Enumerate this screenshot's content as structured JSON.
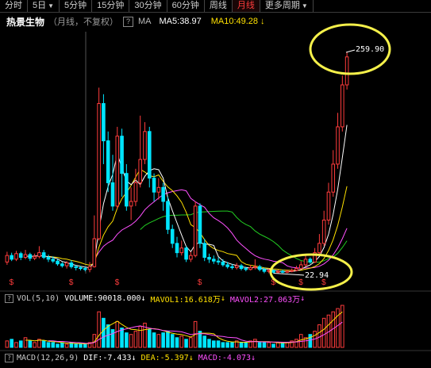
{
  "tabs": [
    {
      "label": "分时",
      "active": false
    },
    {
      "label": "5日",
      "active": false,
      "dropdown": true
    },
    {
      "label": "5分钟",
      "active": false
    },
    {
      "label": "15分钟",
      "active": false
    },
    {
      "label": "30分钟",
      "active": false
    },
    {
      "label": "60分钟",
      "active": false
    },
    {
      "label": "周线",
      "active": false
    },
    {
      "label": "月线",
      "active": true
    },
    {
      "label": "更多周期",
      "active": false,
      "dropdown": true
    }
  ],
  "title": {
    "stock_name": "热景生物",
    "subtitle": "（月线，不复权）",
    "help": "?",
    "indicator": "MA",
    "ma5": "MA5:38.97",
    "ma10": "MA10:49.28",
    "ma10_arrow": "↓"
  },
  "price_labels": {
    "high": "259.90",
    "low": "22.94"
  },
  "volume": {
    "indicator": "VOL(5,10)",
    "volume": "VOLUME:90018.000",
    "volume_arrow": "↓",
    "mavol1": "MAVOL1:16.618万",
    "mavol1_arrow": "↓",
    "mavol2": "MAVOL2:27.063万",
    "mavol2_arrow": "↓"
  },
  "macd": {
    "indicator": "MACD(12,26,9)",
    "dif": "DIF:-7.433",
    "dif_arrow": "↓",
    "dea": "DEA:-5.397",
    "dea_arrow": "↓",
    "macd": "MACD:-4.073",
    "macd_arrow": "↓"
  },
  "colors": {
    "up": "#ff3c3c",
    "down": "#00e5ff",
    "ma5": "#ffffff",
    "ma10": "#ffe100",
    "ma20": "#ff50ff",
    "ma30": "#22cc22",
    "annotation": "#f5f04a"
  },
  "chart_data": {
    "type": "candlestick",
    "period": "monthly",
    "high_marker": 259.9,
    "low_marker": 22.94,
    "candles": [
      {
        "o": 35,
        "c": 42,
        "h": 46,
        "l": 32
      },
      {
        "o": 42,
        "c": 38,
        "h": 45,
        "l": 36
      },
      {
        "o": 38,
        "c": 44,
        "h": 47,
        "l": 36
      },
      {
        "o": 44,
        "c": 40,
        "h": 46,
        "l": 37
      },
      {
        "o": 40,
        "c": 43,
        "h": 48,
        "l": 38
      },
      {
        "o": 43,
        "c": 39,
        "h": 45,
        "l": 36
      },
      {
        "o": 39,
        "c": 41,
        "h": 44,
        "l": 37
      },
      {
        "o": 41,
        "c": 45,
        "h": 52,
        "l": 39
      },
      {
        "o": 45,
        "c": 40,
        "h": 48,
        "l": 38
      },
      {
        "o": 40,
        "c": 38,
        "h": 43,
        "l": 35
      },
      {
        "o": 38,
        "c": 36,
        "h": 41,
        "l": 34
      },
      {
        "o": 36,
        "c": 33,
        "h": 38,
        "l": 31
      },
      {
        "o": 33,
        "c": 31,
        "h": 35,
        "l": 29
      },
      {
        "o": 31,
        "c": 34,
        "h": 36,
        "l": 28
      },
      {
        "o": 34,
        "c": 30,
        "h": 37,
        "l": 28
      },
      {
        "o": 30,
        "c": 29,
        "h": 32,
        "l": 26
      },
      {
        "o": 29,
        "c": 28,
        "h": 31,
        "l": 26
      },
      {
        "o": 28,
        "c": 27,
        "h": 30,
        "l": 25
      },
      {
        "o": 27,
        "c": 30,
        "h": 35,
        "l": 24
      },
      {
        "o": 30,
        "c": 60,
        "h": 85,
        "l": 29
      },
      {
        "o": 60,
        "c": 205,
        "h": 222,
        "l": 58
      },
      {
        "o": 205,
        "c": 165,
        "h": 215,
        "l": 140
      },
      {
        "o": 165,
        "c": 120,
        "h": 175,
        "l": 110
      },
      {
        "o": 120,
        "c": 95,
        "h": 150,
        "l": 90
      },
      {
        "o": 95,
        "c": 170,
        "h": 180,
        "l": 92
      },
      {
        "o": 170,
        "c": 130,
        "h": 178,
        "l": 105
      },
      {
        "o": 130,
        "c": 95,
        "h": 140,
        "l": 90
      },
      {
        "o": 95,
        "c": 100,
        "h": 115,
        "l": 80
      },
      {
        "o": 100,
        "c": 120,
        "h": 135,
        "l": 95
      },
      {
        "o": 120,
        "c": 145,
        "h": 192,
        "l": 115
      },
      {
        "o": 145,
        "c": 175,
        "h": 185,
        "l": 140
      },
      {
        "o": 175,
        "c": 125,
        "h": 180,
        "l": 115
      },
      {
        "o": 125,
        "c": 110,
        "h": 130,
        "l": 100
      },
      {
        "o": 110,
        "c": 115,
        "h": 125,
        "l": 102
      },
      {
        "o": 115,
        "c": 100,
        "h": 120,
        "l": 90
      },
      {
        "o": 100,
        "c": 70,
        "h": 105,
        "l": 65
      },
      {
        "o": 70,
        "c": 55,
        "h": 75,
        "l": 50
      },
      {
        "o": 55,
        "c": 45,
        "h": 62,
        "l": 40
      },
      {
        "o": 45,
        "c": 50,
        "h": 58,
        "l": 42
      },
      {
        "o": 50,
        "c": 38,
        "h": 52,
        "l": 35
      },
      {
        "o": 38,
        "c": 42,
        "h": 46,
        "l": 35
      },
      {
        "o": 42,
        "c": 95,
        "h": 100,
        "l": 40
      },
      {
        "o": 95,
        "c": 55,
        "h": 98,
        "l": 50
      },
      {
        "o": 55,
        "c": 40,
        "h": 60,
        "l": 36
      },
      {
        "o": 40,
        "c": 38,
        "h": 44,
        "l": 34
      },
      {
        "o": 38,
        "c": 36,
        "h": 42,
        "l": 33
      },
      {
        "o": 36,
        "c": 35,
        "h": 40,
        "l": 32
      },
      {
        "o": 35,
        "c": 32,
        "h": 38,
        "l": 30
      },
      {
        "o": 32,
        "c": 30,
        "h": 35,
        "l": 28
      },
      {
        "o": 30,
        "c": 29,
        "h": 33,
        "l": 27
      },
      {
        "o": 29,
        "c": 31,
        "h": 34,
        "l": 27
      },
      {
        "o": 31,
        "c": 28,
        "h": 33,
        "l": 26
      },
      {
        "o": 28,
        "c": 27,
        "h": 30,
        "l": 25
      },
      {
        "o": 27,
        "c": 29,
        "h": 32,
        "l": 26
      },
      {
        "o": 29,
        "c": 30,
        "h": 38,
        "l": 27
      },
      {
        "o": 30,
        "c": 27,
        "h": 32,
        "l": 25
      },
      {
        "o": 27,
        "c": 25,
        "h": 29,
        "l": 23
      },
      {
        "o": 25,
        "c": 26,
        "h": 28,
        "l": 23
      },
      {
        "o": 26,
        "c": 24,
        "h": 27,
        "l": 22.94
      },
      {
        "o": 24,
        "c": 25,
        "h": 27,
        "l": 23
      },
      {
        "o": 25,
        "c": 24,
        "h": 27,
        "l": 23
      },
      {
        "o": 24,
        "c": 25,
        "h": 27,
        "l": 23
      },
      {
        "o": 25,
        "c": 26,
        "h": 28,
        "l": 24
      },
      {
        "o": 26,
        "c": 28,
        "h": 31,
        "l": 25
      },
      {
        "o": 28,
        "c": 32,
        "h": 36,
        "l": 27
      },
      {
        "o": 32,
        "c": 38,
        "h": 42,
        "l": 30
      },
      {
        "o": 38,
        "c": 35,
        "h": 40,
        "l": 33
      },
      {
        "o": 35,
        "c": 45,
        "h": 50,
        "l": 34
      },
      {
        "o": 45,
        "c": 55,
        "h": 65,
        "l": 44
      },
      {
        "o": 55,
        "c": 80,
        "h": 90,
        "l": 52
      },
      {
        "o": 80,
        "c": 110,
        "h": 120,
        "l": 75
      },
      {
        "o": 110,
        "c": 140,
        "h": 155,
        "l": 105
      },
      {
        "o": 140,
        "c": 180,
        "h": 195,
        "l": 135
      },
      {
        "o": 180,
        "c": 225,
        "h": 235,
        "l": 175
      },
      {
        "o": 225,
        "c": 255,
        "h": 259.9,
        "l": 220
      }
    ],
    "volume": [
      4,
      5,
      3,
      4,
      6,
      4,
      3,
      5,
      4,
      3,
      3,
      2,
      3,
      2,
      3,
      2,
      2,
      2,
      3,
      8,
      22,
      18,
      14,
      11,
      16,
      12,
      9,
      8,
      10,
      13,
      15,
      11,
      9,
      8,
      9,
      10,
      8,
      6,
      7,
      5,
      6,
      16,
      10,
      7,
      5,
      4,
      4,
      3,
      3,
      3,
      4,
      3,
      3,
      4,
      5,
      3,
      3,
      3,
      2,
      3,
      3,
      3,
      4,
      5,
      8,
      6,
      8,
      10,
      14,
      18,
      20,
      22,
      24,
      26
    ],
    "ma_lines": [
      "MA5",
      "MA10",
      "MA20",
      "MA30"
    ]
  }
}
